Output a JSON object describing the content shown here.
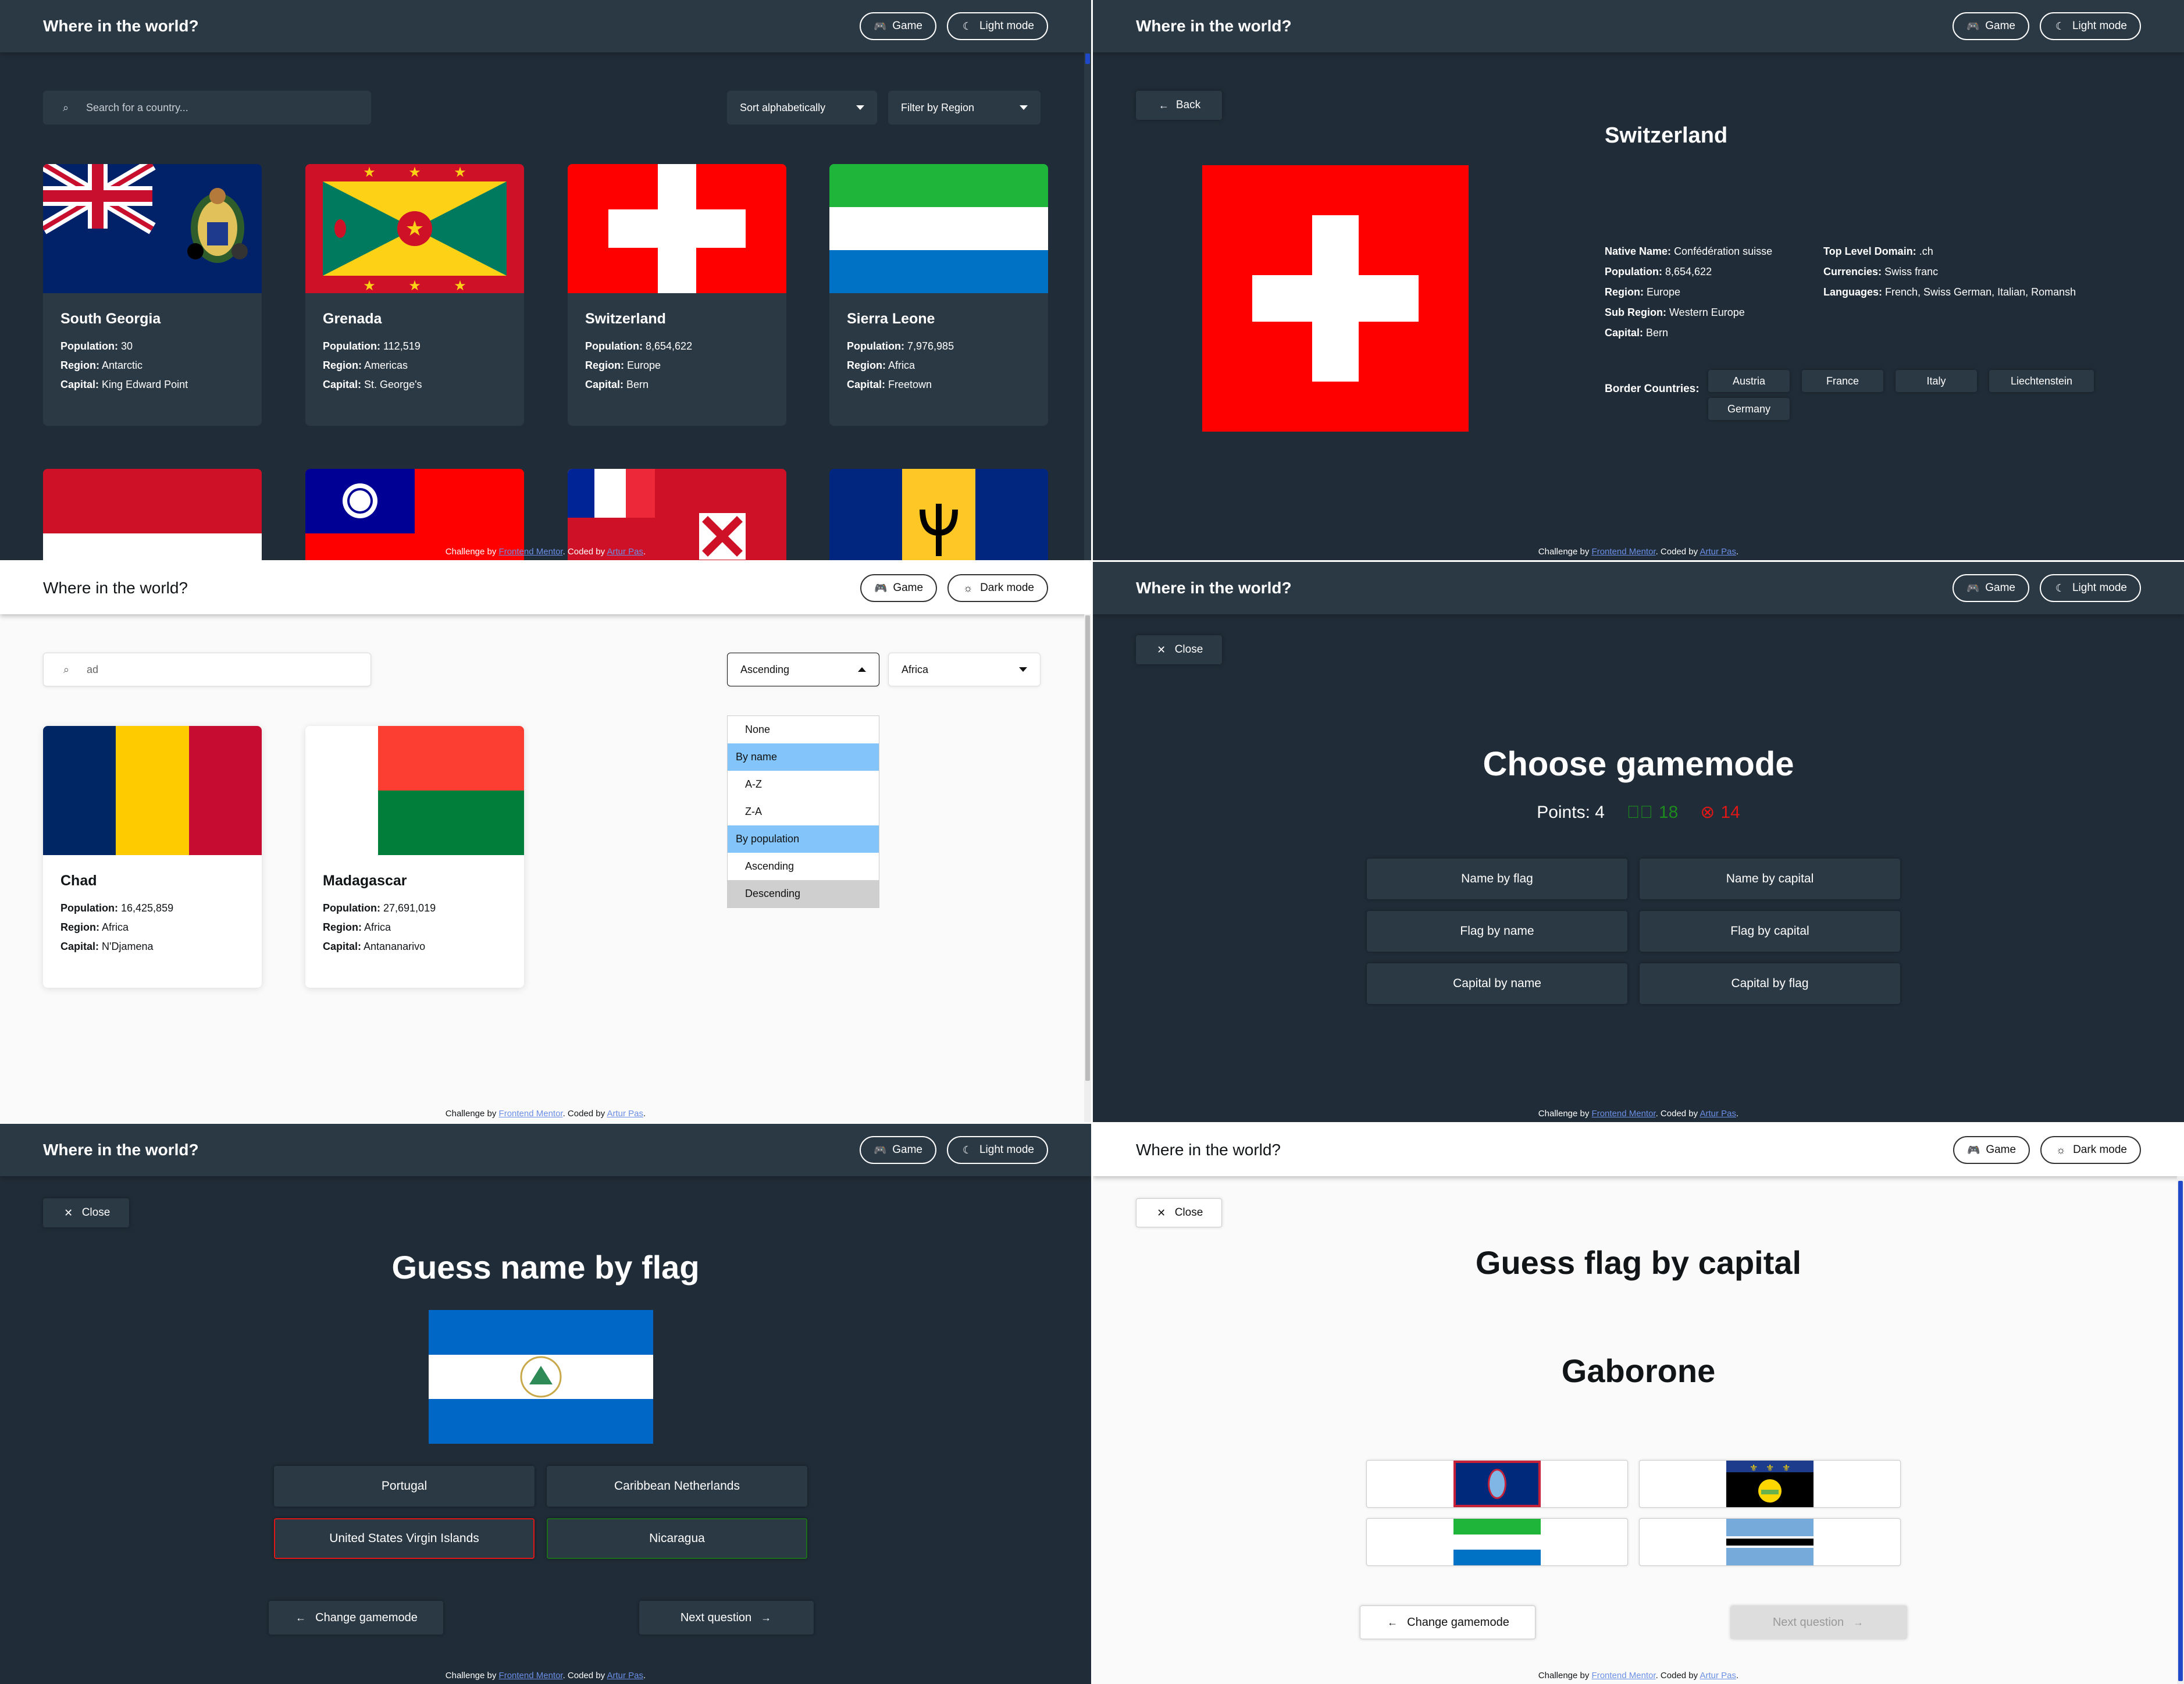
{
  "site_title": "Where in the world?",
  "header": {
    "game_label": "Game",
    "light_mode_label": "Light mode",
    "dark_mode_label": "Dark mode"
  },
  "footer": {
    "prefix": "Challenge by ",
    "fm_link": "Frontend Mentor",
    "middle": ". Coded by ",
    "author_link": "Artur Pas",
    "suffix": "."
  },
  "list_view": {
    "search_placeholder": "Search for a country...",
    "sort_label": "Sort alphabetically",
    "filter_label": "Filter by Region",
    "countries": [
      {
        "name": "South Georgia",
        "population": "30",
        "region": "Antarctic",
        "capital": "King Edward Point"
      },
      {
        "name": "Grenada",
        "population": "112,519",
        "region": "Americas",
        "capital": "St. George's"
      },
      {
        "name": "Switzerland",
        "population": "8,654,622",
        "region": "Europe",
        "capital": "Bern"
      },
      {
        "name": "Sierra Leone",
        "population": "7,976,985",
        "region": "Africa",
        "capital": "Freetown"
      }
    ],
    "field_labels": {
      "population": "Population:",
      "region": "Region:",
      "capital": "Capital:"
    }
  },
  "detail_view": {
    "back_label": "Back",
    "name": "Switzerland",
    "native_name_label": "Native Name:",
    "native_name": "Confédération suisse",
    "population_label": "Population:",
    "population": "8,654,622",
    "region_label": "Region:",
    "region": "Europe",
    "sub_region_label": "Sub Region:",
    "sub_region": "Western Europe",
    "capital_label": "Capital:",
    "capital": "Bern",
    "tld_label": "Top Level Domain:",
    "tld": ".ch",
    "currencies_label": "Currencies:",
    "currencies": "Swiss franc",
    "languages_label": "Languages:",
    "languages": "French, Swiss German, Italian, Romansh",
    "border_label": "Border Countries:",
    "borders": [
      "Austria",
      "France",
      "Italy",
      "Liechtenstein",
      "Germany"
    ]
  },
  "filtered_view": {
    "search_value": "ad",
    "sort_value": "Ascending",
    "region_value": "Africa",
    "sort_options": [
      "None",
      "By name",
      "A-Z",
      "Z-A",
      "By population",
      "Ascending",
      "Descending"
    ],
    "countries": [
      {
        "name": "Chad",
        "population": "16,425,859",
        "region": "Africa",
        "capital": "N'Djamena"
      },
      {
        "name": "Madagascar",
        "population": "27,691,019",
        "region": "Africa",
        "capital": "Antananarivo"
      }
    ]
  },
  "gamemode_view": {
    "close_label": "Close",
    "title": "Choose gamemode",
    "points_label": "Points: 4",
    "correct_count": "18",
    "wrong_count": "14",
    "modes": [
      "Name by flag",
      "Name by capital",
      "Flag by name",
      "Flag by capital",
      "Capital by name",
      "Capital by flag"
    ]
  },
  "name_by_flag": {
    "close_label": "Close",
    "title": "Guess name by flag",
    "options": [
      "Portugal",
      "Caribbean Netherlands",
      "United States Virgin Islands",
      "Nicaragua"
    ],
    "wrong_option": "United States Virgin Islands",
    "correct_option": "Nicaragua",
    "change_label": "Change gamemode",
    "next_label": "Next question"
  },
  "flag_by_capital": {
    "close_label": "Close",
    "title": "Guess flag by capital",
    "capital": "Gaborone",
    "change_label": "Change gamemode",
    "next_label": "Next question"
  },
  "colors": {
    "dark_bg": "#202c37",
    "dark_element": "#2b3945",
    "light_bg": "#fafafa",
    "highlight": "#83c5fb",
    "wrong": "#e01717",
    "correct": "#1c6e1c"
  }
}
